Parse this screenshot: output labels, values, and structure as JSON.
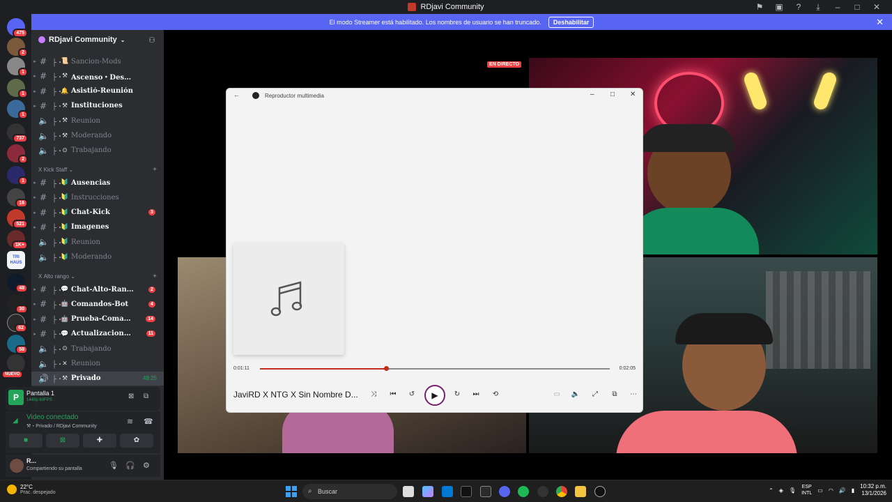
{
  "window": {
    "title": "RDjavi Community"
  },
  "banner": {
    "text": "El modo Streamer está habilitado. Los nombres de usuario se han truncado.",
    "button": "Deshabilitar"
  },
  "rail": {
    "badges": [
      "475",
      "2",
      "1",
      "1",
      "1",
      "737",
      "2",
      "1",
      "16",
      "521",
      "1K+",
      "48",
      "30",
      "62",
      "58"
    ],
    "new_label": "NUEVO",
    "trihaus_label": "TRI HAUS"
  },
  "sidebar": {
    "server_name": "RDjavi Community",
    "channels_top": [
      {
        "name": "Sancion-Mods",
        "kind": "#",
        "emoji": "📜",
        "style": "dim"
      },
      {
        "name": "Ascenso・Descenso",
        "kind": "#",
        "emoji": "⚒",
        "style": "bold"
      },
      {
        "name": "Asistió-Reunión",
        "kind": "#",
        "emoji": "🔔",
        "style": "bold"
      },
      {
        "name": "Instituciones",
        "kind": "#",
        "emoji": "⚒",
        "style": "bold"
      },
      {
        "name": "Reunion",
        "kind": "🔈",
        "emoji": "⚒",
        "style": "dim"
      },
      {
        "name": "Moderando",
        "kind": "🔈",
        "emoji": "⚒",
        "style": "dim"
      },
      {
        "name": "Trabajando",
        "kind": "🔈",
        "emoji": "⊙",
        "style": "dim"
      }
    ],
    "category_kick": "Kick Staff",
    "channels_kick": [
      {
        "name": "Ausencias",
        "kind": "#",
        "emoji": "🔰",
        "style": "bold"
      },
      {
        "name": "Instrucciones",
        "kind": "#",
        "emoji": "🔰",
        "style": "dim"
      },
      {
        "name": "Chat-Kick",
        "kind": "#",
        "emoji": "🔰",
        "style": "bold",
        "count": "3"
      },
      {
        "name": "Imagenes",
        "kind": "#",
        "emoji": "🔰",
        "style": "bold"
      },
      {
        "name": "Reunion",
        "kind": "🔈",
        "emoji": "🔰",
        "style": "dim"
      },
      {
        "name": "Moderando",
        "kind": "🔈",
        "emoji": "🔰",
        "style": "dim"
      }
    ],
    "category_alto": "Alto rango",
    "channels_alto": [
      {
        "name": "Chat-Alto-Rango",
        "kind": "#",
        "emoji": "💬",
        "style": "bold",
        "count": "2"
      },
      {
        "name": "Comandos-Bot",
        "kind": "#",
        "emoji": "🤖",
        "style": "bold",
        "count": "4"
      },
      {
        "name": "Prueba-Comando",
        "kind": "#",
        "emoji": "🤖",
        "style": "bold",
        "count": "14"
      },
      {
        "name": "Actualizaciones...",
        "kind": "#",
        "emoji": "💬",
        "style": "bold",
        "count": "11"
      },
      {
        "name": "Trabajando",
        "kind": "🔈",
        "emoji": "⊙",
        "style": "dim"
      },
      {
        "name": "Reunion",
        "kind": "🔈",
        "emoji": "✕",
        "style": "dim"
      },
      {
        "name": "Privado",
        "kind": "🔊",
        "emoji": "⚒",
        "style": "active",
        "timer": "48:25"
      }
    ]
  },
  "screen_share": {
    "title": "Pantalla 1",
    "quality": "1440p 60FPS",
    "thumb_letter": "P"
  },
  "voice": {
    "state": "Video conectado",
    "where": "⚒・Privado / RDjavi Community"
  },
  "user": {
    "name": "R...",
    "status": "Compartiendo su pantalla"
  },
  "stage": {
    "live_label": "EN DIRECTO"
  },
  "player": {
    "app_title": "Reproductor multimedia",
    "elapsed": "0:01:11",
    "total": "0:02:05",
    "progress": 0.36,
    "song": "JaviRD X NTG X Sin Nombre D..."
  },
  "taskbar": {
    "temp": "22°C",
    "weather": "Prac. despejado",
    "search": "Buscar",
    "lang1": "ESP",
    "lang2": "INTL",
    "time": "10:32 p.m.",
    "date": "13/1/2026"
  }
}
